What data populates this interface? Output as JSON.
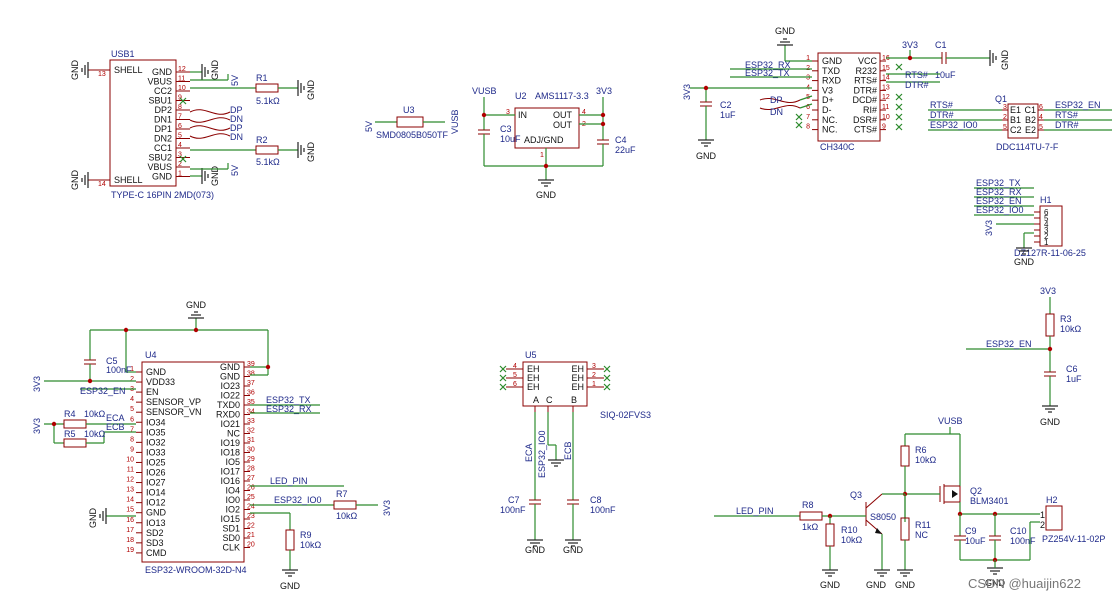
{
  "usb1": {
    "ref": "USB1",
    "part": "TYPE-C 16PIN 2MD(073)",
    "left_pins": [
      {
        "n": "13",
        "name": "SHELL"
      },
      {
        "n": "14",
        "name": "SHELL"
      }
    ],
    "right_pins": [
      {
        "n": "12",
        "name": "GND"
      },
      {
        "n": "11",
        "name": "VBUS"
      },
      {
        "n": "10",
        "name": "CC2"
      },
      {
        "n": "9",
        "name": "SBU1"
      },
      {
        "n": "8",
        "name": "DP2"
      },
      {
        "n": "7",
        "name": "DN1"
      },
      {
        "n": "6",
        "name": "DP1"
      },
      {
        "n": "5",
        "name": "DN2"
      },
      {
        "n": "4",
        "name": "CC1"
      },
      {
        "n": "3",
        "name": "SBU2"
      },
      {
        "n": "2",
        "name": "VBUS"
      },
      {
        "n": "1",
        "name": "GND"
      }
    ],
    "net_dp": "DP",
    "net_dn": "DN"
  },
  "r1": {
    "ref": "R1",
    "value": "5.1kΩ"
  },
  "r2": {
    "ref": "R2",
    "value": "5.1kΩ"
  },
  "u3": {
    "ref": "U3",
    "part": "SMD0805B050TF",
    "left": "5V",
    "right": "VUSB"
  },
  "u2": {
    "ref": "U2",
    "part": "AMS1117-3.3",
    "net_in": "VUSB",
    "net_out": "3V3",
    "pins": [
      {
        "n": "3",
        "name": "IN"
      },
      {
        "n": "4",
        "name": "OUT"
      },
      {
        "n": "2",
        "name": "OUT"
      },
      {
        "n": "1",
        "name": "ADJ/GND"
      }
    ]
  },
  "c3": {
    "ref": "C3",
    "value": "10uF"
  },
  "c4": {
    "ref": "C4",
    "value": "22uF"
  },
  "ch340": {
    "ref": "CH340C",
    "left_pins": [
      {
        "n": "1",
        "name": "GND"
      },
      {
        "n": "2",
        "name": "TXD"
      },
      {
        "n": "3",
        "name": "RXD"
      },
      {
        "n": "4",
        "name": "V3"
      },
      {
        "n": "5",
        "name": "D+"
      },
      {
        "n": "6",
        "name": "D-"
      },
      {
        "n": "7",
        "name": "NC."
      },
      {
        "n": "8",
        "name": "NC."
      }
    ],
    "right_pins": [
      {
        "n": "16",
        "name": "VCC"
      },
      {
        "n": "15",
        "name": "R232"
      },
      {
        "n": "14",
        "name": "RTS#"
      },
      {
        "n": "13",
        "name": "DTR#"
      },
      {
        "n": "12",
        "name": "DCD#"
      },
      {
        "n": "11",
        "name": "RI#"
      },
      {
        "n": "10",
        "name": "DSR#"
      },
      {
        "n": "9",
        "name": "CTS#"
      }
    ],
    "nets_left": [
      "ESP32_RX",
      "ESP32_TX",
      "DP",
      "DN"
    ],
    "nets_right": [
      "RTS#",
      "DTR#"
    ],
    "net_vcc": "3V3"
  },
  "c1": {
    "ref": "C1",
    "value": "10uF"
  },
  "c2": {
    "ref": "C2",
    "value": "1uF"
  },
  "q1": {
    "ref": "Q1",
    "part": "DDC114TU-7-F",
    "left_pins": [
      {
        "n": "3",
        "name": "E1"
      },
      {
        "n": "2",
        "name": "B1"
      },
      {
        "n": "5",
        "name": "C2"
      }
    ],
    "right_pins": [
      {
        "n": "6",
        "name": "C1"
      },
      {
        "n": "4",
        "name": "B2"
      },
      {
        "n": "5",
        "name": "E2"
      }
    ],
    "nets_left": [
      "RTS#",
      "DTR#",
      "ESP32_IO0"
    ],
    "nets_right": [
      "ESP32_EN",
      "RTS#",
      "DTR#"
    ]
  },
  "h1": {
    "ref": "H1",
    "part": "DZ127R-11-06-25",
    "nets": [
      "ESP32_TX",
      "ESP32_RX",
      "ESP32_EN",
      "ESP32_IO0",
      "3V3"
    ],
    "pins": [
      "6",
      "5",
      "4",
      "3",
      "2",
      "1"
    ]
  },
  "u4": {
    "ref": "U4",
    "part": "ESP32-WROOM-32D-N4",
    "left_pins": [
      {
        "n": "1",
        "name": "GND"
      },
      {
        "n": "2",
        "name": "VDD33"
      },
      {
        "n": "3",
        "name": "EN"
      },
      {
        "n": "4",
        "name": "SENSOR_VP"
      },
      {
        "n": "5",
        "name": "SENSOR_VN"
      },
      {
        "n": "6",
        "name": "IO34"
      },
      {
        "n": "7",
        "name": "IO35"
      },
      {
        "n": "8",
        "name": "IO32"
      },
      {
        "n": "9",
        "name": "IO33"
      },
      {
        "n": "10",
        "name": "IO25"
      },
      {
        "n": "11",
        "name": "IO26"
      },
      {
        "n": "12",
        "name": "IO27"
      },
      {
        "n": "13",
        "name": "IO14"
      },
      {
        "n": "14",
        "name": "IO12"
      },
      {
        "n": "15",
        "name": "GND"
      },
      {
        "n": "16",
        "name": "IO13"
      },
      {
        "n": "17",
        "name": "SD2"
      },
      {
        "n": "18",
        "name": "SD3"
      },
      {
        "n": "19",
        "name": "CMD"
      }
    ],
    "right_pins": [
      {
        "n": "39",
        "name": "GND"
      },
      {
        "n": "38",
        "name": "GND"
      },
      {
        "n": "37",
        "name": "IO23"
      },
      {
        "n": "36",
        "name": "IO22"
      },
      {
        "n": "35",
        "name": "TXD0"
      },
      {
        "n": "34",
        "name": "RXD0"
      },
      {
        "n": "33",
        "name": "IO21"
      },
      {
        "n": "32",
        "name": "NC"
      },
      {
        "n": "31",
        "name": "IO19"
      },
      {
        "n": "30",
        "name": "IO18"
      },
      {
        "n": "29",
        "name": "IO5"
      },
      {
        "n": "28",
        "name": "IO17"
      },
      {
        "n": "27",
        "name": "IO16"
      },
      {
        "n": "26",
        "name": "IO4"
      },
      {
        "n": "25",
        "name": "IO0"
      },
      {
        "n": "24",
        "name": "IO2"
      },
      {
        "n": "23",
        "name": "IO15"
      },
      {
        "n": "22",
        "name": "SD1"
      },
      {
        "n": "21",
        "name": "SD0"
      },
      {
        "n": "20",
        "name": "CLK"
      }
    ],
    "nets": {
      "en": "ESP32_EN",
      "tx": "ESP32_TX",
      "rx": "ESP32_RX",
      "led": "LED_PIN",
      "io0": "ESP32_IO0",
      "eca": "ECA",
      "ecb": "ECB"
    }
  },
  "c5": {
    "ref": "C5",
    "value": "100nF"
  },
  "r4": {
    "ref": "R4",
    "value": "10kΩ"
  },
  "r5": {
    "ref": "R5",
    "value": "10kΩ"
  },
  "r7": {
    "ref": "R7",
    "value": "10kΩ"
  },
  "r9": {
    "ref": "R9",
    "value": "10kΩ"
  },
  "u5": {
    "ref": "U5",
    "part": "SIQ-02FVS3",
    "left_pins": [
      {
        "n": "4",
        "name": "EH"
      },
      {
        "n": "5",
        "name": "EH"
      },
      {
        "n": "6",
        "name": "EH"
      }
    ],
    "right_pins": [
      {
        "n": "3",
        "name": "EH"
      },
      {
        "n": "2",
        "name": "EH"
      },
      {
        "n": "1",
        "name": "EH"
      }
    ],
    "bottom_pins": [
      {
        "n": "A",
        "name": "A"
      },
      {
        "n": "C",
        "name": "C"
      },
      {
        "n": "B",
        "name": "B"
      }
    ],
    "nets": [
      "ECA",
      "ESP32_IO0",
      "ECB"
    ]
  },
  "c7": {
    "ref": "C7",
    "value": "100nF"
  },
  "c8": {
    "ref": "C8",
    "value": "100nF"
  },
  "r3": {
    "ref": "R3",
    "value": "10kΩ"
  },
  "c6": {
    "ref": "C6",
    "value": "1uF"
  },
  "en_net": "ESP32_EN",
  "r6": {
    "ref": "R6",
    "value": "10kΩ"
  },
  "r8": {
    "ref": "R8",
    "value": "1kΩ"
  },
  "r10": {
    "ref": "R10",
    "value": "10kΩ"
  },
  "r11": {
    "ref": "R11",
    "value": "NC"
  },
  "q3": {
    "ref": "Q3",
    "part": "S8050"
  },
  "q2": {
    "ref": "Q2",
    "part": "BLM3401"
  },
  "c9": {
    "ref": "C9",
    "value": "10uF"
  },
  "c10": {
    "ref": "C10",
    "value": "100nF"
  },
  "h2": {
    "ref": "H2",
    "part": "PZ254V-11-02P",
    "pins": [
      "1",
      "2"
    ]
  },
  "led_net": "LED_PIN",
  "vusb_net": "VUSB",
  "gnd": "GND",
  "v3v3": "3V3",
  "v5": "5V",
  "watermark": "CSDN @huaijin622",
  "colors": {
    "wire": "#2e8b2e",
    "body": "#8b0000",
    "text": "#1f2a8a",
    "junction": "#b00000"
  }
}
